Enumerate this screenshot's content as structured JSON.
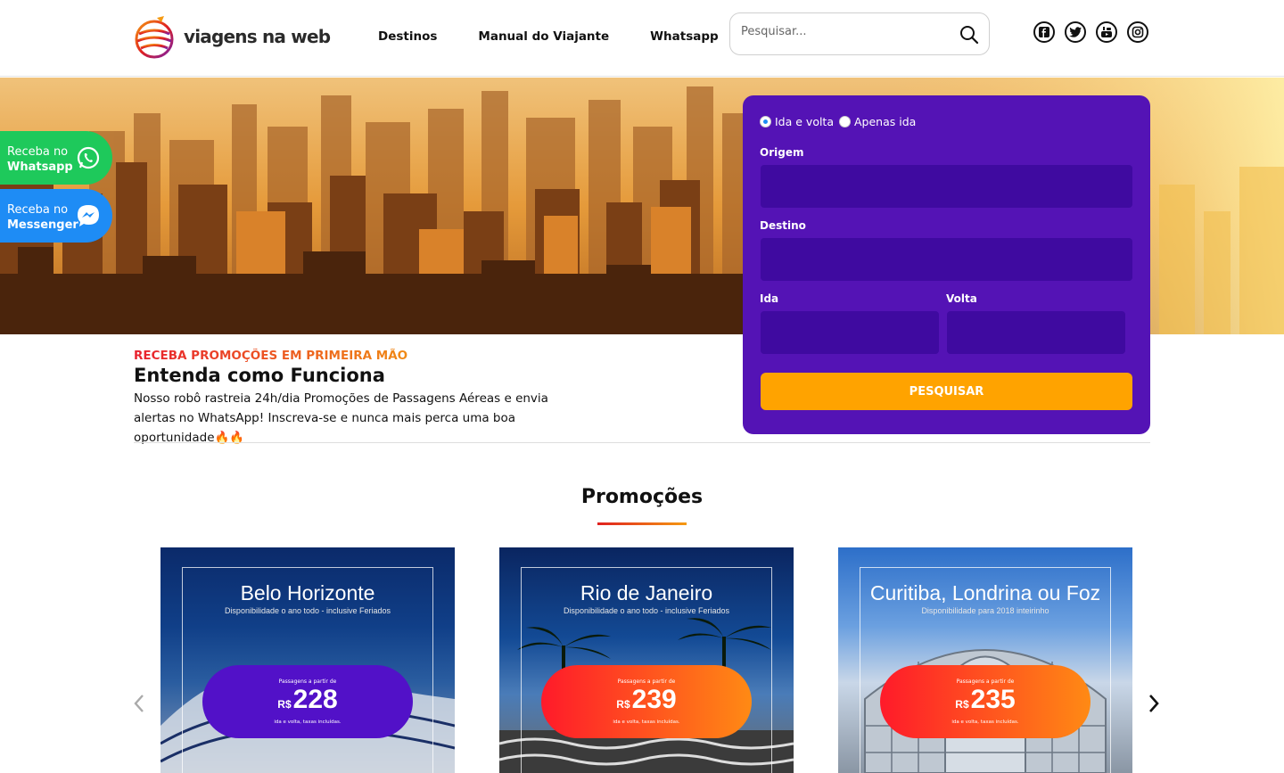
{
  "brand": {
    "name": "viagens na web"
  },
  "nav": {
    "items": [
      "Destinos",
      "Manual do Viajante",
      "Whatsapp"
    ]
  },
  "search": {
    "placeholder": "Pesquisar..."
  },
  "social": [
    "facebook-icon",
    "twitter-icon",
    "youtube-icon",
    "instagram-icon"
  ],
  "float_buttons": {
    "whatsapp": {
      "line1": "Receba no",
      "line2": "Whatsapp"
    },
    "messenger": {
      "line1": "Receba no",
      "line2": "Messenger"
    }
  },
  "form": {
    "trip_roundtrip": "Ida e volta",
    "trip_oneway": "Apenas ida",
    "origin_label": "Origem",
    "destination_label": "Destino",
    "departure_label": "Ida",
    "return_label": "Volta",
    "submit": "PESQUISAR"
  },
  "intro": {
    "kicker": "RECEBA PROMOÇÕES EM PRIMEIRA MÃO",
    "title": "Entenda como Funciona",
    "text": "Nosso robô rastreia 24h/dia Promoções de Passagens Aéreas e envia alertas no WhatsApp! Inscreva-se e nunca mais perca uma boa oportunidade🔥🔥"
  },
  "promos": {
    "title": "Promoções",
    "cards": [
      {
        "city": "Belo Horizonte",
        "subtitle": "Disponibilidade o ano todo - inclusive Feriados",
        "from": "Passagens a partir de",
        "currency": "R$",
        "price": "228",
        "note": "ida e volta, taxas incluídas."
      },
      {
        "city": "Rio de Janeiro",
        "subtitle": "Disponibilidade o ano todo - inclusive Feriados",
        "from": "Passagens a partir de",
        "currency": "R$",
        "price": "239",
        "note": "ida e volta, taxas incluídas."
      },
      {
        "city": "Curitiba, Londrina ou Foz",
        "subtitle": "Disponibilidade para 2018 inteirinho",
        "from": "Passagens a partir de",
        "currency": "R$",
        "price": "235",
        "note": "ida e volta, taxas incluídas."
      }
    ]
  },
  "colors": {
    "form_bg": "#5413b5",
    "accent": "#ffa300",
    "whatsapp": "#1ec95b",
    "messenger": "#1e8cf5"
  }
}
